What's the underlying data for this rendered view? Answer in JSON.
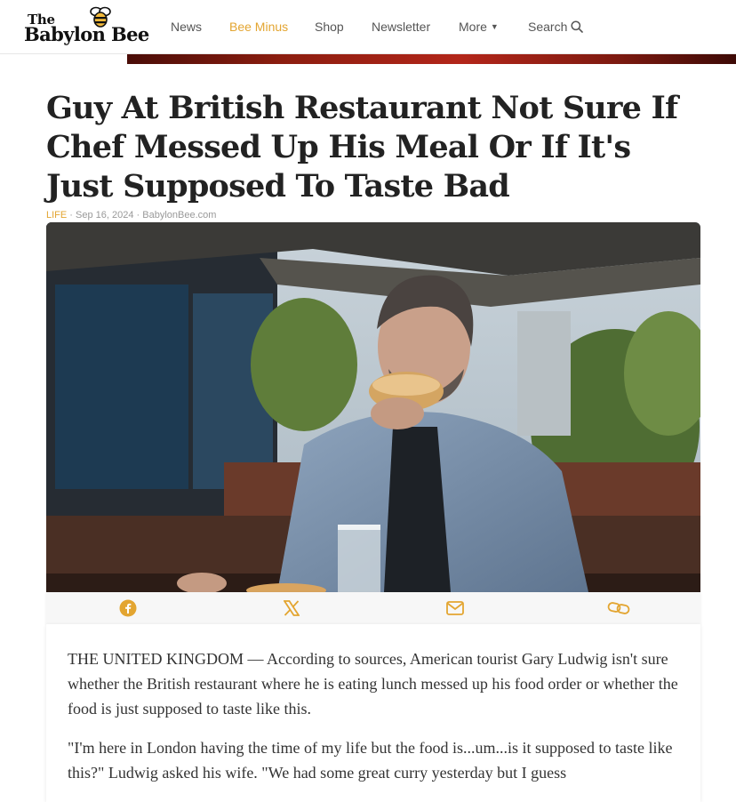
{
  "header": {
    "logo_line1": "The",
    "logo_line2": "Babylon Bee",
    "nav": {
      "news": "News",
      "bee_minus": "Bee Minus",
      "shop": "Shop",
      "newsletter": "Newsletter",
      "more": "More",
      "search": "Search"
    },
    "icons": {
      "more": "caret-down-icon",
      "search": "search-icon",
      "logo": "bee-icon"
    }
  },
  "article": {
    "title": "Guy At British Restaurant Not Sure If Chef Messed Up His Meal Or If It's Just Supposed To Taste Bad",
    "category": "LIFE",
    "date": "Sep 16, 2024",
    "source": "BabylonBee.com",
    "separator": " · ",
    "share_icons": [
      "facebook-icon",
      "x-icon",
      "email-icon",
      "link-icon"
    ],
    "paragraphs": [
      "THE UNITED KINGDOM — According to sources, American tourist Gary Ludwig isn't sure whether the British restaurant where he is eating lunch messed up his food order or whether the food is just supposed to taste like this.",
      "\"I'm here in London having the time of my life but the food is...um...is it supposed to taste like this?\" Ludwig asked his wife. \"We had some great curry yesterday but I guess"
    ]
  },
  "colors": {
    "accent": "#e3a531",
    "text": "#222222",
    "share_icon": "#e3a531"
  }
}
